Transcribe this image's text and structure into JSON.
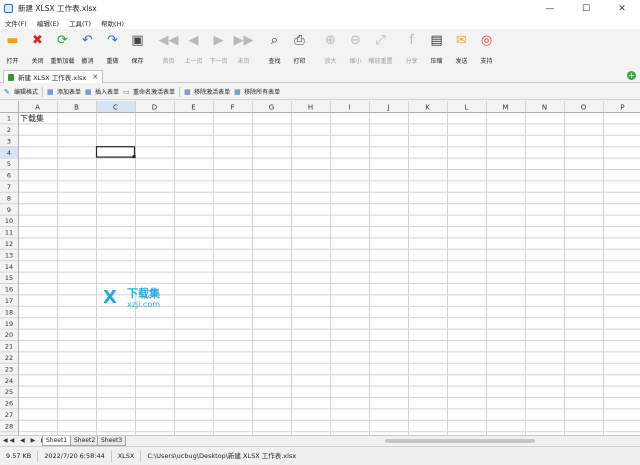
{
  "window": {
    "title": "新建 XLSX 工作表.xlsx",
    "minimize": "—",
    "maximize": "☐",
    "close": "✕"
  },
  "menu": [
    "文件(F)",
    "编辑(E)",
    "工具(T)",
    "帮助(H)"
  ],
  "toolbar": [
    {
      "label": "打开",
      "icon": "folder-icon",
      "glyph": "▬",
      "color": "#f0a020",
      "enabled": true
    },
    {
      "label": "关闭",
      "icon": "close-red-icon",
      "glyph": "✖",
      "color": "#d62828",
      "enabled": true
    },
    {
      "label": "重新加载",
      "icon": "reload-icon",
      "glyph": "⟳",
      "color": "#2f9a3a",
      "enabled": true
    },
    {
      "label": "撤消",
      "icon": "undo-icon",
      "glyph": "↶",
      "color": "#2d6fd1",
      "enabled": true
    },
    {
      "label": "重做",
      "icon": "redo-icon",
      "glyph": "↷",
      "color": "#2d6fd1",
      "enabled": true
    },
    {
      "label": "保存",
      "icon": "save-icon",
      "glyph": "▣",
      "color": "#444444",
      "enabled": true
    },
    {
      "label": "首页",
      "icon": "first-page-icon",
      "glyph": "◀◀",
      "color": "#b9b9b9",
      "enabled": false
    },
    {
      "label": "上一页",
      "icon": "prev-page-icon",
      "glyph": "◀",
      "color": "#b9b9b9",
      "enabled": false
    },
    {
      "label": "下一页",
      "icon": "next-page-icon",
      "glyph": "▶",
      "color": "#b9b9b9",
      "enabled": false
    },
    {
      "label": "末页",
      "icon": "last-page-icon",
      "glyph": "▶▶",
      "color": "#b9b9b9",
      "enabled": false
    },
    {
      "label": "查找",
      "icon": "find-icon",
      "glyph": "⌕",
      "color": "#333333",
      "enabled": true
    },
    {
      "label": "打印",
      "icon": "print-icon",
      "glyph": "⎙",
      "color": "#333333",
      "enabled": true
    },
    {
      "label": "放大",
      "icon": "zoom-in-icon",
      "glyph": "⊕",
      "color": "#b9b9b9",
      "enabled": false
    },
    {
      "label": "缩小",
      "icon": "zoom-out-icon",
      "glyph": "⊖",
      "color": "#b9b9b9",
      "enabled": false
    },
    {
      "label": "缩放重置",
      "icon": "zoom-reset-icon",
      "glyph": "⤢",
      "color": "#b9b9b9",
      "enabled": false
    },
    {
      "label": "分享",
      "icon": "facebook-share-icon",
      "glyph": "f",
      "color": "#b9b9b9",
      "enabled": false
    },
    {
      "label": "压缩",
      "icon": "zip-icon",
      "glyph": "▤",
      "color": "#333333",
      "enabled": true
    },
    {
      "label": "发送",
      "icon": "email-icon",
      "glyph": "✉",
      "color": "#e8a83a",
      "enabled": true
    },
    {
      "label": "支持",
      "icon": "lifebuoy-icon",
      "glyph": "◎",
      "color": "#e04b3a",
      "enabled": true
    }
  ],
  "doc_tab": {
    "name": "新建 XLSX 工作表.xlsx",
    "close": "✕",
    "add": "+"
  },
  "sheet_tools": [
    {
      "label": "编辑格式",
      "icon": "pencil-icon",
      "glyph": "✎"
    },
    {
      "label": "添加表单",
      "icon": "add-sheet-icon",
      "glyph": "▦"
    },
    {
      "label": "插入表单",
      "icon": "insert-sheet-icon",
      "glyph": "▦"
    },
    {
      "label": "重命名激活表单",
      "icon": "rename-sheet-icon",
      "glyph": "▭"
    },
    {
      "label": "移除激活表单",
      "icon": "remove-sheet-icon",
      "glyph": "▦"
    },
    {
      "label": "移除所有表单",
      "icon": "remove-all-sheets-icon",
      "glyph": "▦"
    }
  ],
  "grid": {
    "columns": [
      "A",
      "B",
      "C",
      "D",
      "E",
      "F",
      "G",
      "H",
      "I",
      "J",
      "K",
      "L",
      "M",
      "N",
      "O",
      "P"
    ],
    "rows": 28,
    "selected_cell": "C4",
    "cells": {
      "A1": "下载集"
    }
  },
  "watermark": {
    "logo": "X",
    "cn": "下载集",
    "url": "xzji.com"
  },
  "sheets": [
    "Sheet1",
    "Sheet2",
    "Sheet3"
  ],
  "sheet_nav": "◀◀ ◀ ▶ ▶▶",
  "status": [
    "9.57 KB",
    "2022/7/20 6:58:44",
    "XLSX",
    "C:\\Users\\ucbug\\Desktop\\新建 XLSX 工作表.xlsx"
  ]
}
